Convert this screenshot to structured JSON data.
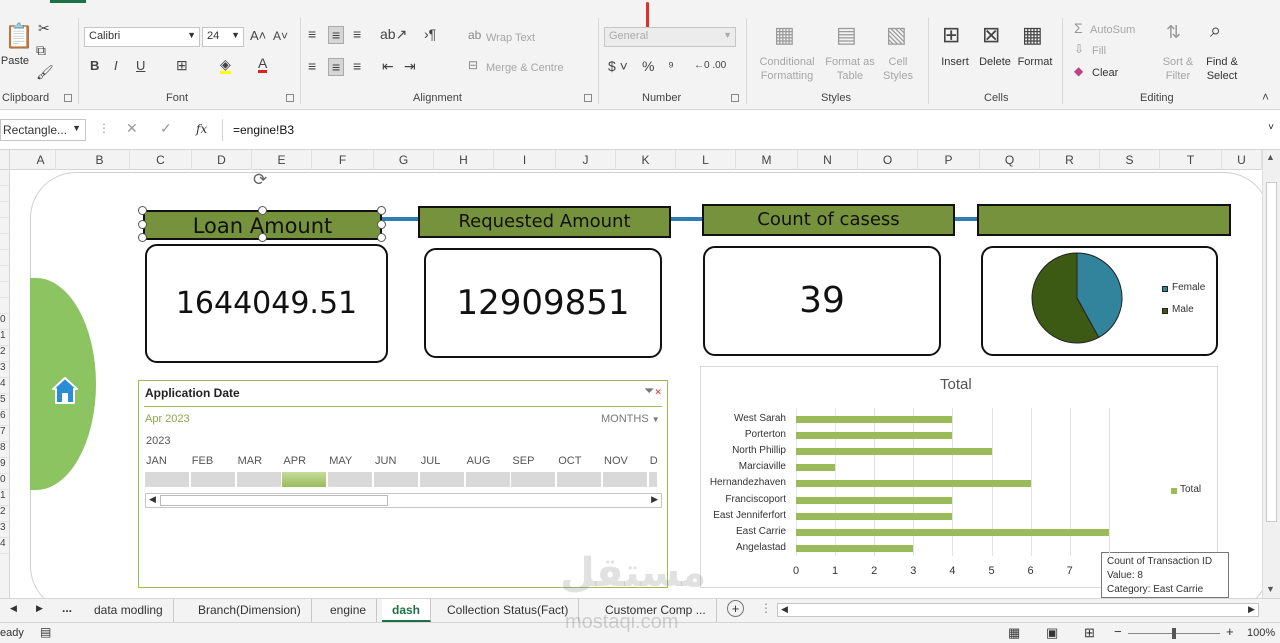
{
  "ribbon": {
    "clipboard": {
      "label": "Clipboard",
      "paste": "Paste"
    },
    "font": {
      "label": "Font",
      "name": "Calibri",
      "size": "24",
      "bold": "B",
      "italic": "I",
      "underline": "U"
    },
    "alignment": {
      "label": "Alignment",
      "wrap_text": "Wrap Text",
      "merge_centre": "Merge & Centre"
    },
    "number": {
      "label": "Number",
      "format": "General"
    },
    "styles": {
      "label": "Styles",
      "conditional_1": "Conditional",
      "conditional_2": "Formatting",
      "format_table_1": "Format as",
      "format_table_2": "Table",
      "cell_styles_1": "Cell",
      "cell_styles_2": "Styles"
    },
    "cells": {
      "label": "Cells",
      "insert": "Insert",
      "delete": "Delete",
      "format": "Format"
    },
    "editing": {
      "label": "Editing",
      "autosum": "AutoSum",
      "fill": "Fill",
      "clear": "Clear",
      "sort_1": "Sort &",
      "sort_2": "Filter",
      "find_1": "Find &",
      "find_2": "Select"
    }
  },
  "formula_bar": {
    "name_box": "Rectangle...",
    "fx": "fx",
    "formula": "=engine!B3"
  },
  "columns": [
    "A",
    "B",
    "C",
    "D",
    "E",
    "F",
    "G",
    "H",
    "I",
    "J",
    "K",
    "L",
    "M",
    "N",
    "O",
    "P",
    "Q",
    "R",
    "S",
    "T",
    "U"
  ],
  "rows": [
    "",
    "",
    "",
    "",
    "",
    "",
    "",
    "",
    "",
    "0",
    "1",
    "2",
    "3",
    "4",
    "5",
    "6",
    "7",
    "8",
    "9",
    "0",
    "1",
    "2",
    "3",
    "4"
  ],
  "dashboard": {
    "titles": {
      "loan": "Loan Amount",
      "requested": "Requested Amount",
      "count": "Count of casess",
      "fourth": ""
    },
    "kpis": {
      "loan": "1644049.51",
      "requested": "12909851",
      "count": "39"
    },
    "pie": {
      "female_label": "Female",
      "male_label": "Male",
      "female_share": 0.42,
      "male_share": 0.58,
      "female_color": "#31849b",
      "male_color": "#3c5a14"
    },
    "slicer": {
      "title": "Application Date",
      "period": "Apr 2023",
      "unit": "MONTHS",
      "year": "2023",
      "months": [
        "JAN",
        "FEB",
        "MAR",
        "APR",
        "MAY",
        "JUN",
        "JUL",
        "AUG",
        "SEP",
        "OCT",
        "NOV",
        "D"
      ],
      "selected_index": 3
    },
    "tooltip": {
      "line1": "Count of Transaction ID",
      "line2": "Value: 8",
      "line3": "Category: East Carrie"
    }
  },
  "chart_data": {
    "type": "bar",
    "title": "Total",
    "categories": [
      "West Sarah",
      "Porterton",
      "North Phillip",
      "Marciaville",
      "Hernandezhaven",
      "Franciscoport",
      "East Jenniferfort",
      "East Carrie",
      "Angelastad"
    ],
    "series": [
      {
        "name": "Total",
        "values": [
          4,
          4,
          5,
          1,
          6,
          4,
          4,
          8,
          3
        ],
        "color": "#9bbb59"
      }
    ],
    "xlim": [
      0,
      8
    ],
    "xticks": [
      "0",
      "1",
      "2",
      "3",
      "4",
      "5",
      "6",
      "7"
    ],
    "grid": true,
    "legend": "right"
  },
  "sheet_tabs": [
    "data modling",
    "Branch(Dimension)",
    "engine",
    "dash",
    "Collection Status(Fact)",
    "Customer Comp ..."
  ],
  "active_tab": "dash",
  "status": {
    "ready": "eady",
    "zoom": "100%"
  },
  "watermark": {
    "arabic": "مستقل",
    "latin": "mostaqi.com"
  }
}
